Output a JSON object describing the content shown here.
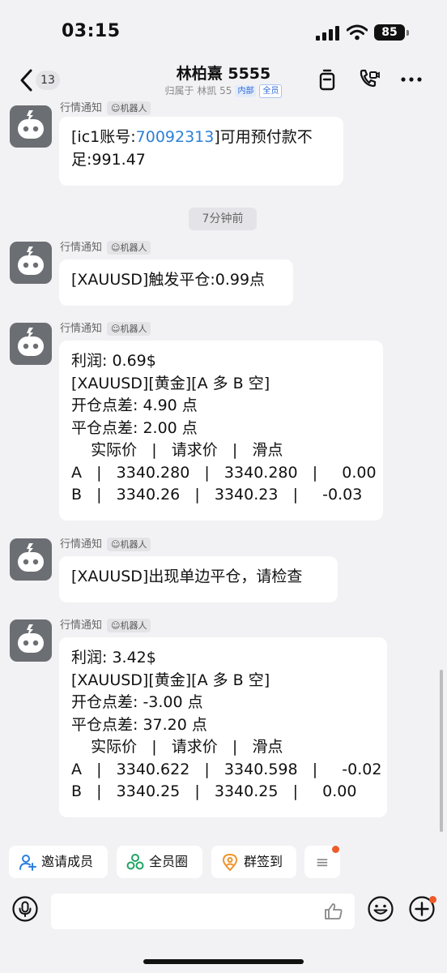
{
  "status": {
    "time": "03:15",
    "battery": "85"
  },
  "nav": {
    "back_count": "13",
    "title": "林柏熹 5555",
    "subtitle": "归属于 林凯 55",
    "tag_internal": "内部",
    "tag_all": "全员",
    "icons": [
      "clipboard-icon",
      "video-call-icon",
      "more-icon"
    ]
  },
  "sender": {
    "name": "行情通知",
    "bot_label": "机器人"
  },
  "time_separator": "7分钟前",
  "messages": [
    {
      "line1_pre": "[ic1账号:",
      "account": "70092313",
      "line1_post": "]可用预付款不",
      "line2": "足:991.47"
    },
    {
      "text": "[XAUUSD]触发平仓:0.99点"
    },
    {
      "lines": [
        "利润: 0.69$",
        "[XAUUSD][黄金][A 多 B 空]",
        "开仓点差: 4.90 点",
        "平仓点差: 2.00 点",
        "    实际价   |   请求价   |   滑点",
        "A   |   3340.280   |   3340.280   |     0.00",
        "B   |   3340.26   |   3340.23   |     -0.03"
      ]
    },
    {
      "text": "[XAUUSD]出现单边平仓，请检查"
    },
    {
      "lines": [
        "利润: 3.42$",
        "[XAUUSD][黄金][A 多 B 空]",
        "开仓点差: -3.00 点",
        "平仓点差: 37.20 点",
        "    实际价   |   请求价   |   滑点",
        "A   |   3340.622   |   3340.598   |     -0.02",
        "B   |   3340.25   |   3340.25   |     0.00"
      ]
    }
  ],
  "quick_actions": [
    {
      "label": "邀请成员",
      "icon": "invite-member-icon"
    },
    {
      "label": "全员圈",
      "icon": "all-members-circle-icon"
    },
    {
      "label": "群签到",
      "icon": "group-checkin-icon"
    }
  ],
  "quick_more_label": "≡",
  "input": {
    "icons": [
      "voice-icon",
      "thumbs-up-icon",
      "emoji-icon",
      "plus-icon"
    ]
  },
  "colors": {
    "link": "#2d80d8",
    "accent_red": "#ee5a2a",
    "avatar": "#6b6e73",
    "tag_blue": "#2a67d8"
  }
}
